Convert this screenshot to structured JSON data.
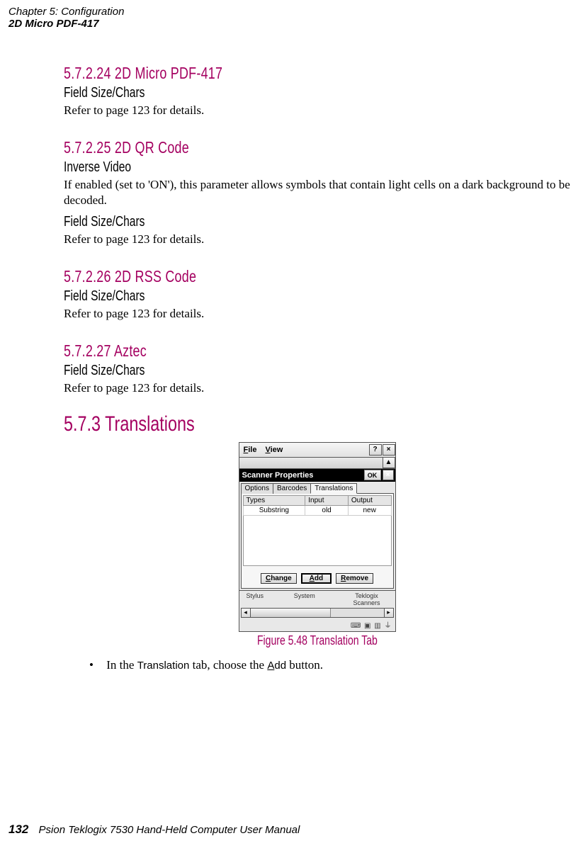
{
  "header": {
    "line1": "Chapter 5: Configuration",
    "line2": "2D Micro PDF-417"
  },
  "sections": {
    "s24_title": "5.7.2.24    2D Micro PDF-417",
    "s24_sub": "Field Size/Chars",
    "s24_body": "Refer to page 123 for details.",
    "s25_title": "5.7.2.25    2D QR Code",
    "s25_sub1": "Inverse Video",
    "s25_body1": "If enabled (set to 'ON'), this parameter allows symbols that contain light cells on a dark background to be decoded.",
    "s25_sub2": "Field Size/Chars",
    "s25_body2": "Refer to page 123 for details.",
    "s26_title": "5.7.2.26    2D RSS Code",
    "s26_sub": "Field Size/Chars",
    "s26_body": "Refer to page 123 for details.",
    "s27_title": "5.7.2.27    Aztec",
    "s27_sub": "Field Size/Chars",
    "s27_body": "Refer to page 123 for details.",
    "s573_title": "5.7.3   Translations"
  },
  "window": {
    "menu_file": "File",
    "menu_view": "View",
    "help": "?",
    "close": "×",
    "up": "▲",
    "titlebar": "Scanner Properties",
    "ok": "OK",
    "tab1": "Options",
    "tab2": "Barcodes",
    "tab3": "Translations",
    "col_types": "Types",
    "col_input": "Input",
    "col_output": "Output",
    "row_types": "Substring",
    "row_input": "old",
    "row_output": "new",
    "btn_change": "Change",
    "btn_add": "Add",
    "btn_remove": "Remove",
    "foot1": "Stylus",
    "foot2": "System",
    "foot3": "Teklogix Scanners",
    "left_arrow": "◂",
    "right_arrow": "▸",
    "tray": "⌨ ▣ ▥ ⏚"
  },
  "figcap": "Figure 5.48 Translation Tab",
  "bullet": {
    "pre": "In the ",
    "mid": "Translation",
    "mid2": " tab, choose the ",
    "add": "Add",
    "post": " button."
  },
  "footer": {
    "page": "132",
    "text": "Psion Teklogix 7530 Hand-Held Computer User Manual"
  }
}
